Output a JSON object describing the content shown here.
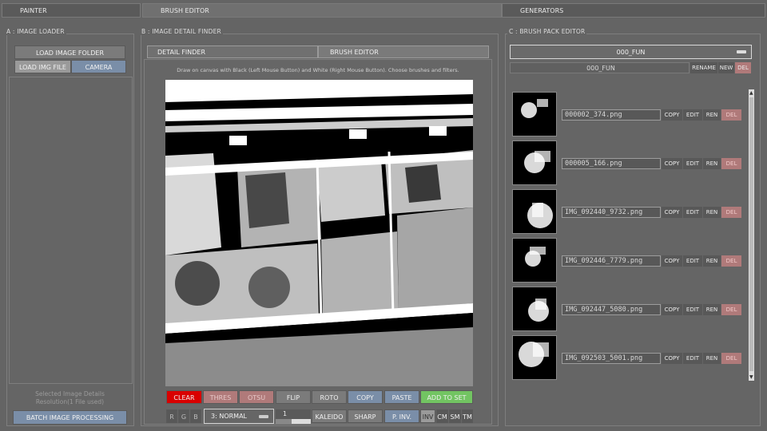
{
  "top_tabs": [
    "PAINTER",
    "BRUSH EDITOR",
    "GENERATORS"
  ],
  "panel_a": {
    "title": "A : IMAGE LOADER",
    "load_folder": "LOAD IMAGE FOLDER",
    "load_file": "LOAD IMG FILE",
    "camera": "CAMERA",
    "details_line1": "Selected Image Details",
    "details_line2": "Resolution(1 File used)",
    "batch": "BATCH IMAGE PROCESSING"
  },
  "panel_b": {
    "title": "B : IMAGE DETAIL FINDER",
    "tab_detail": "DETAIL FINDER",
    "tab_brush": "BRUSH EDITOR",
    "instructions": "Draw on canvas with Black (Left Mouse Button) and White (Right Mouse Button). Choose brushes and filters.",
    "row1": [
      "CLEAR",
      "THRES",
      "OTSU",
      "FLIP",
      "ROTO",
      "COPY",
      "PASTE",
      "ADD TO SET"
    ],
    "rgb": [
      "R",
      "G",
      "B"
    ],
    "mode": "3: NORMAL",
    "slider_value": "1",
    "row2": [
      "KALEIDO",
      "SHARP",
      "P. INV.",
      "INV",
      "CM",
      "SM",
      "TM"
    ]
  },
  "panel_c": {
    "title": "C : BRUSH PACK EDITOR",
    "pack_select": "000_FUN",
    "pack_name": "000_FUN",
    "rename": "RENAME",
    "new": "NEW",
    "del": "DEL",
    "item_actions": [
      "COPY",
      "EDIT",
      "REN",
      "DEL"
    ],
    "items": [
      {
        "name": "000002_374.png"
      },
      {
        "name": "000005_166.png"
      },
      {
        "name": "IMG_092440_9732.png"
      },
      {
        "name": "IMG_092446_7779.png"
      },
      {
        "name": "IMG_092447_5080.png"
      },
      {
        "name": "IMG_092503_5001.png"
      }
    ]
  },
  "colors": {
    "clear": "#d90000",
    "add_to_set": "#72c462",
    "blue_button": "#7a8ea8",
    "del_button": "#b07a7a"
  }
}
